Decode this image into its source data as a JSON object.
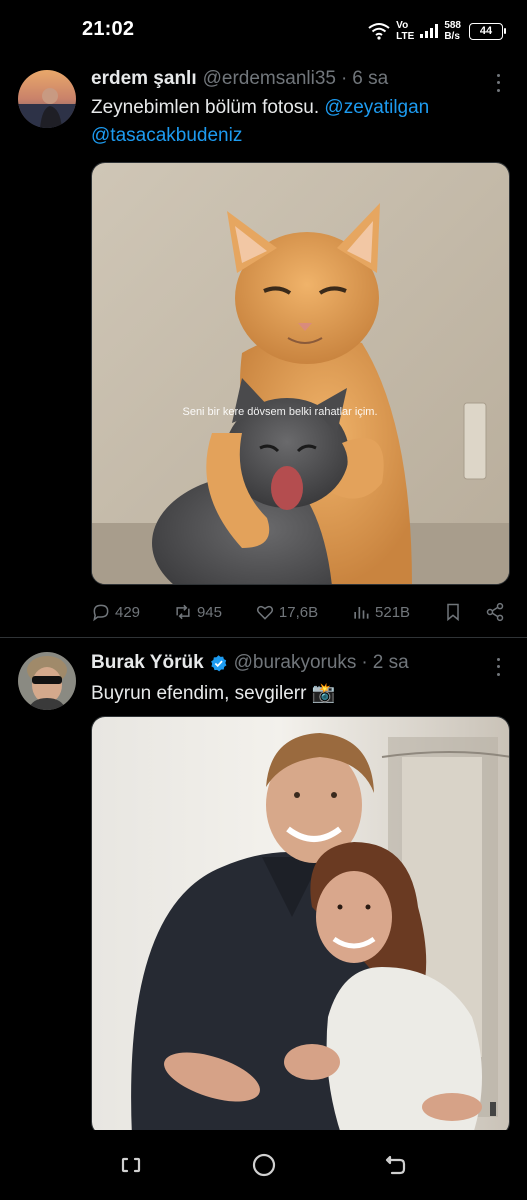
{
  "status_bar": {
    "time": "21:02",
    "network_top": "Vo",
    "network_bottom": "LTE",
    "speed_value": "588",
    "speed_unit": "B/s",
    "battery": "44"
  },
  "tweets": [
    {
      "display_name": "erdem şanlı",
      "handle": "@erdemsanli35",
      "separator": "·",
      "time": "6 sa",
      "text": "Zeynebimlen bölüm fotosu. ",
      "mention_1": "@zeyatilgan",
      "mention_2": "@tasacakbudeniz",
      "image_caption": "Seni bir kere dövsem belki rahatlar içim.",
      "replies": "429",
      "retweets": "945",
      "likes": "17,6B",
      "views": "521B"
    },
    {
      "display_name": "Burak Yörük",
      "verified": true,
      "handle": "@burakyoruks",
      "separator": "·",
      "time": "2 sa",
      "text": "Buyrun efendim, sevgilerr 📸"
    }
  ],
  "colors": {
    "background": "#000000",
    "text": "#e7e9ea",
    "secondary": "#71767b",
    "accent": "#1d9bf0",
    "divider": "#2f3336"
  },
  "icons": {
    "reply": "reply-icon",
    "retweet": "retweet-icon",
    "like": "heart-icon",
    "views": "views-icon",
    "bookmark": "bookmark-icon",
    "share": "share-icon",
    "more": "more-icon",
    "verified": "verified-badge-icon"
  }
}
